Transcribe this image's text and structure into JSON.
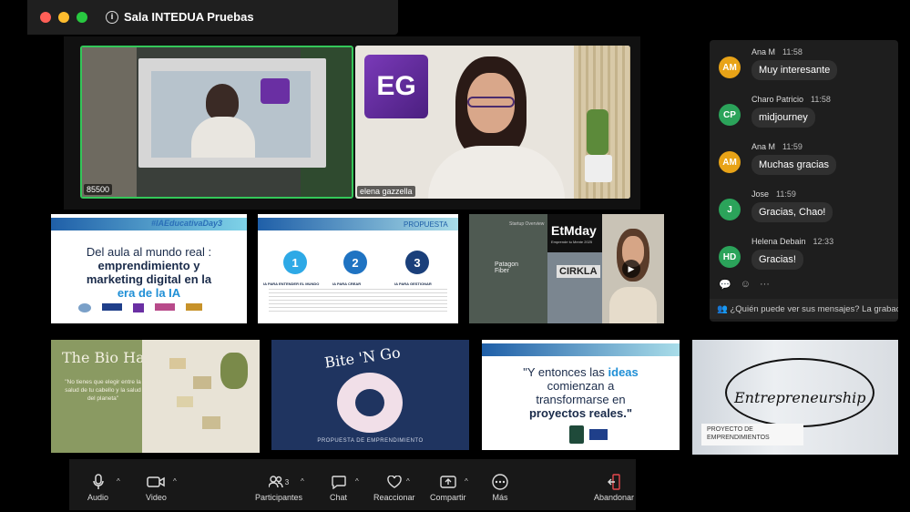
{
  "window": {
    "title": "Sala INTEDUA Pruebas"
  },
  "participants_video": [
    {
      "name": "85500"
    },
    {
      "name": "elena gazzella"
    }
  ],
  "logo": {
    "text": "EG",
    "color": "#6a2fa3"
  },
  "slides": {
    "s1": {
      "tag": "#IAEducativaDay3",
      "line1": "Del aula al mundo real :",
      "line2": "emprendimiento y",
      "line3": "marketing digital en la",
      "line4": "era de la IA"
    },
    "s2": {
      "header": "PROPUESTA",
      "n1": "1",
      "n2": "2",
      "n3": "3",
      "c1": "IA PARA ENTENDER EL MUNDO",
      "c2": "IA PARA CREAR",
      "c3": "IA PARA GESTIONAR"
    },
    "s3": {
      "brand": "EtMday",
      "sub": "Emprende tu Mente 2025",
      "b1": "CIRKLA",
      "b2": "Patagon Fiber",
      "b3": "Startup Overview"
    },
    "s4": {
      "title": "The Bio Hair",
      "quote": "\"No tienes que elegir entre la salud de tu cabello y la salud del planeta\""
    },
    "s5": {
      "title": "Bite 'N Go",
      "caption": "PROPUESTA DE EMPRENDIMIENTO"
    },
    "s6": {
      "l1": "\"Y entonces las",
      "l1b": "ideas",
      "l2": "comienzan a",
      "l3": "transformarse en",
      "l4": "proyectos reales.\""
    },
    "s7": {
      "title": "Entrepreneurship",
      "caption1": "PROYECTO DE",
      "caption2": "EMPRENDIMIENTOS"
    }
  },
  "chat": {
    "messages": [
      {
        "initials": "AM",
        "sender": "Ana M",
        "time": "11:58",
        "text": "Muy interesante",
        "color": "#e8a317"
      },
      {
        "initials": "CP",
        "sender": "Charo Patricio",
        "time": "11:58",
        "text": "midjourney",
        "color": "#2ba35a"
      },
      {
        "initials": "AM",
        "sender": "Ana M",
        "time": "11:59",
        "text": "Muchas gracias",
        "color": "#e8a317"
      },
      {
        "initials": "J",
        "sender": "Jose",
        "time": "11:59",
        "text": "Gracias, Chao!",
        "color": "#2ba35a"
      },
      {
        "initials": "HD",
        "sender": "Helena Debain",
        "time": "12:33",
        "text": "Gracias!",
        "color": "#2ba35a"
      }
    ],
    "who_can_see": "¿Quién puede ver sus mensajes? La grabación"
  },
  "toolbar": {
    "audio": "Audio",
    "video": "Video",
    "participants": "Participantes",
    "participants_count": "3",
    "chat": "Chat",
    "react": "Reaccionar",
    "share": "Compartir",
    "more": "Más",
    "leave": "Abandonar"
  }
}
